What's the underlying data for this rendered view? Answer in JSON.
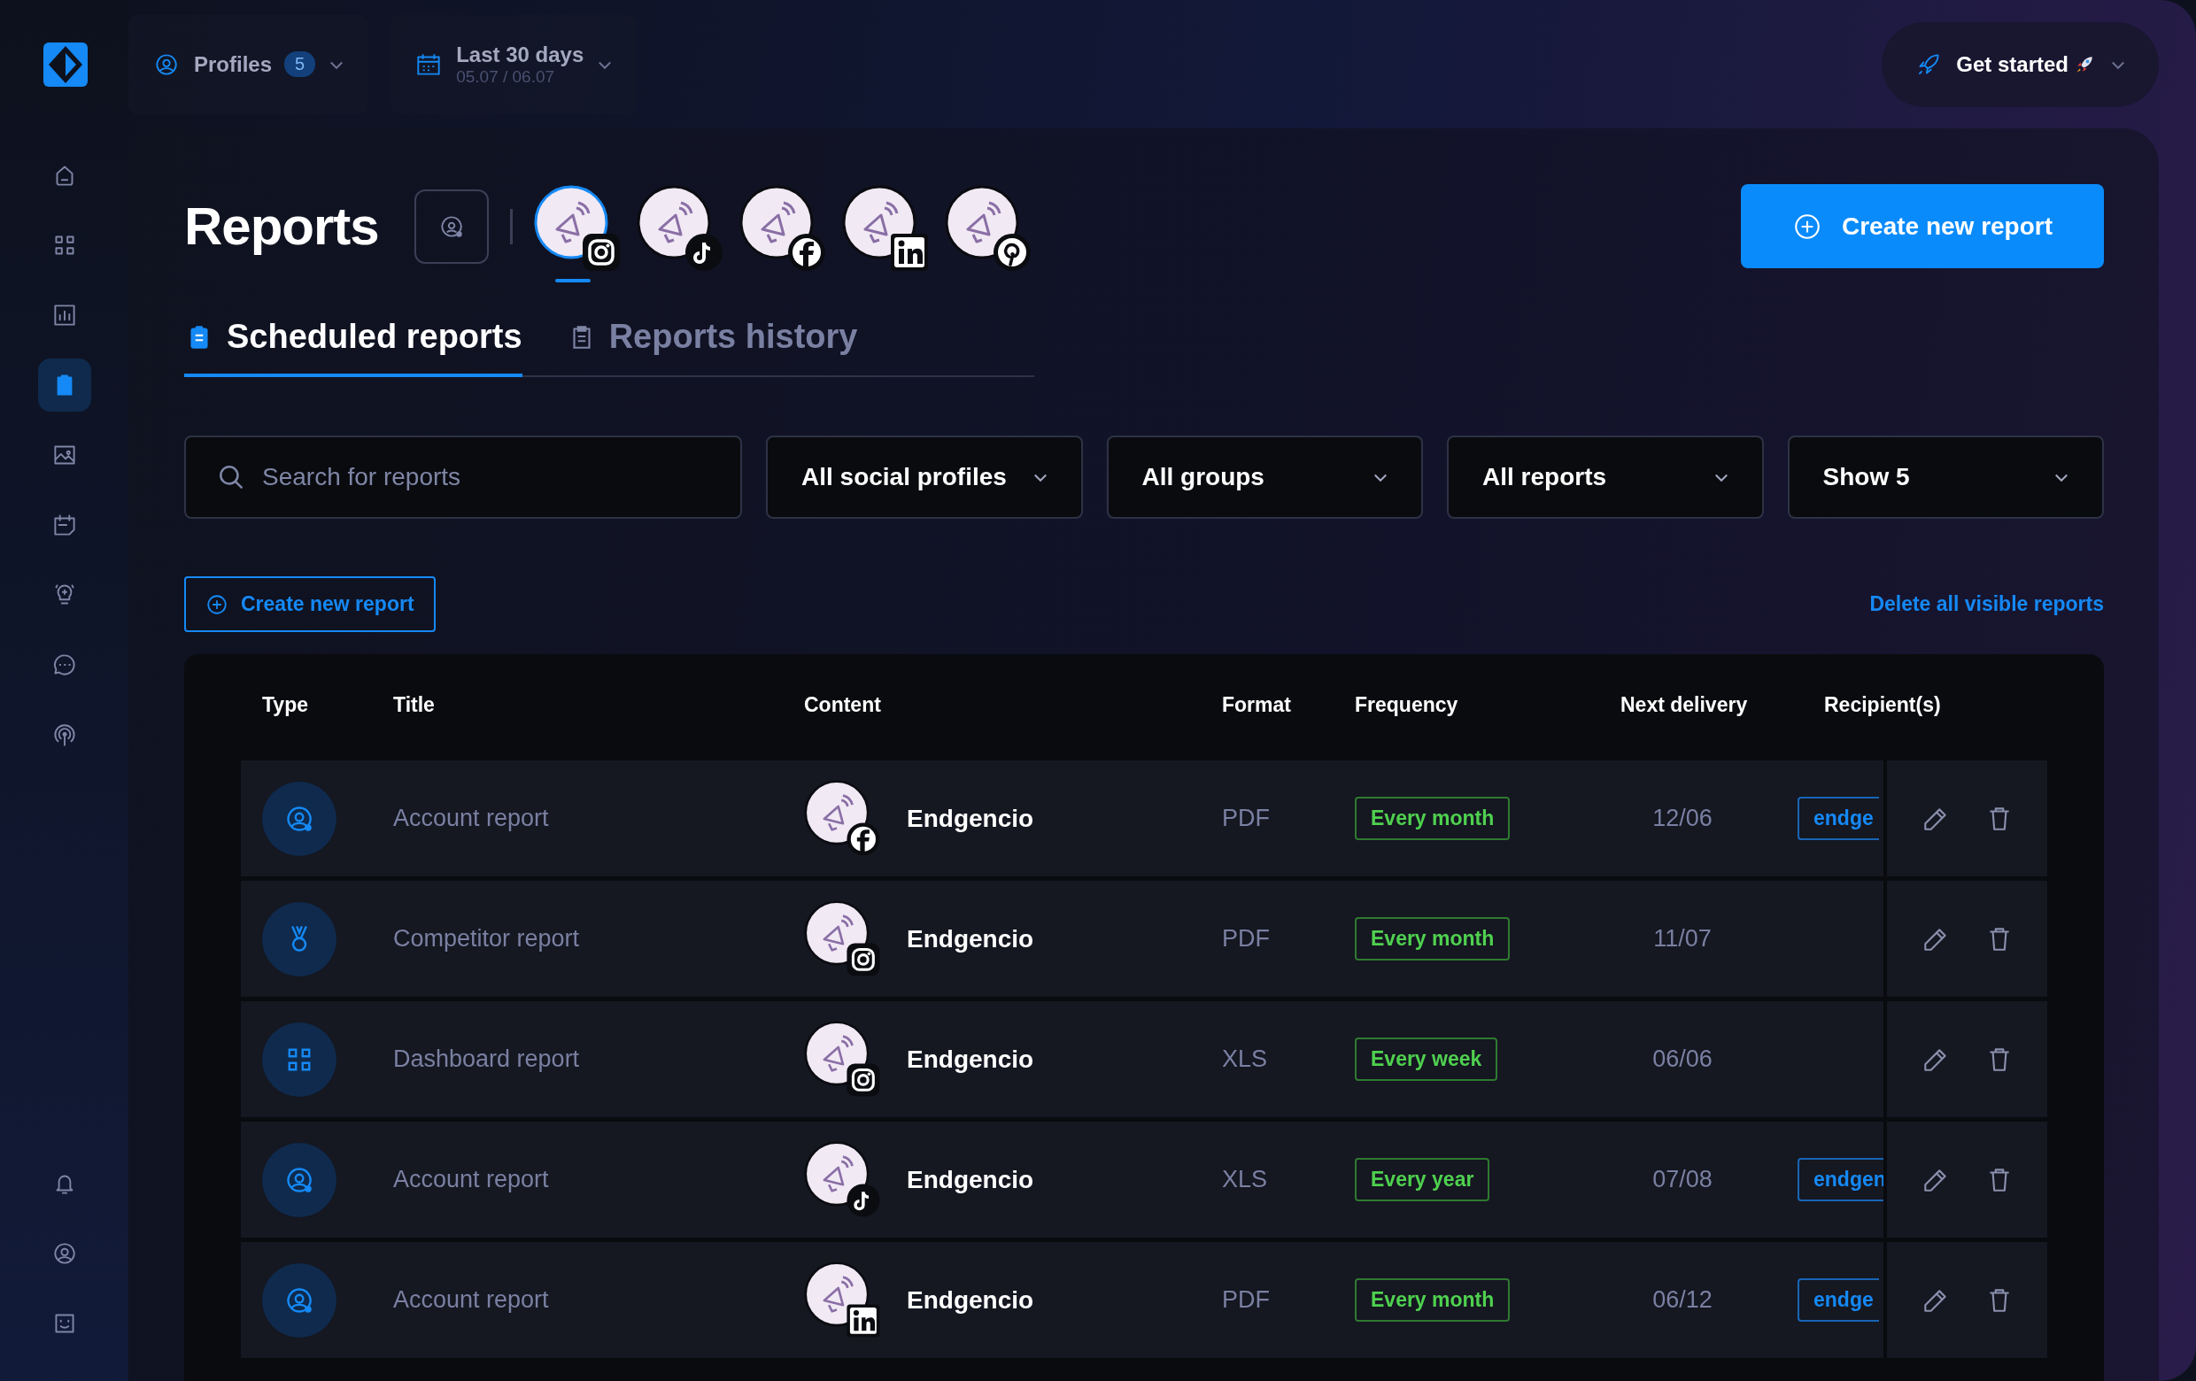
{
  "sidebar": {
    "items": [
      {
        "kind": "home",
        "selected": false
      },
      {
        "kind": "grid",
        "selected": false
      },
      {
        "kind": "chart",
        "selected": false
      },
      {
        "kind": "clipboard",
        "selected": true
      },
      {
        "kind": "image",
        "selected": false
      },
      {
        "kind": "calendar",
        "selected": false
      },
      {
        "kind": "bulb",
        "selected": false
      },
      {
        "kind": "chat",
        "selected": false
      },
      {
        "kind": "broadcast",
        "selected": false
      }
    ],
    "bottom_items": [
      {
        "kind": "bell"
      },
      {
        "kind": "user"
      },
      {
        "kind": "smile"
      }
    ]
  },
  "topbar": {
    "profiles": {
      "label": "Profiles",
      "count": "5"
    },
    "date_range": {
      "label": "Last 30 days",
      "dates": "05.07 / 06.07"
    },
    "get_started": {
      "label": "Get started"
    }
  },
  "header": {
    "title": "Reports",
    "profiles": [
      {
        "kind": "instagram",
        "selected": true
      },
      {
        "kind": "tiktok",
        "selected": false
      },
      {
        "kind": "facebook",
        "selected": false
      },
      {
        "kind": "linkedin",
        "selected": false
      },
      {
        "kind": "pinterest",
        "selected": false
      }
    ],
    "create_button": "Create new report"
  },
  "tabs": [
    {
      "label": "Scheduled reports",
      "selected": true
    },
    {
      "label": "Reports history",
      "selected": false
    }
  ],
  "filters": {
    "search": {
      "placeholder": "Search for reports"
    },
    "dropdowns": [
      "All social profiles",
      "All groups",
      "All reports",
      "Show 5"
    ]
  },
  "actions": {
    "create": "Create new report",
    "delete_all": "Delete all visible reports"
  },
  "table": {
    "columns": [
      "Type",
      "Title",
      "Content",
      "Format",
      "Frequency",
      "Next delivery",
      "Recipient(s)"
    ],
    "rows": [
      {
        "type": {
          "kind": "account"
        },
        "title": "Account report",
        "profile": {
          "kind": "facebook",
          "name": "Endgencio"
        },
        "format": "PDF",
        "frequency": "Every month",
        "next_delivery": "12/06",
        "recipients": [
          "endge"
        ]
      },
      {
        "type": {
          "kind": "competitor"
        },
        "title": "Competitor report",
        "profile": {
          "kind": "instagram",
          "name": "Endgencio"
        },
        "format": "PDF",
        "frequency": "Every month",
        "next_delivery": "11/07",
        "recipients": []
      },
      {
        "type": {
          "kind": "dashboard"
        },
        "title": "Dashboard report",
        "profile": {
          "kind": "instagram",
          "name": "Endgencio"
        },
        "format": "XLS",
        "frequency": "Every week",
        "next_delivery": "06/06",
        "recipients": []
      },
      {
        "type": {
          "kind": "account"
        },
        "title": "Account report",
        "profile": {
          "kind": "tiktok",
          "name": "Endgencio"
        },
        "format": "XLS",
        "frequency": "Every year",
        "next_delivery": "07/08",
        "recipients": [
          "endgen"
        ]
      },
      {
        "type": {
          "kind": "account"
        },
        "title": "Account report",
        "profile": {
          "kind": "linkedin",
          "name": "Endgencio"
        },
        "format": "PDF",
        "frequency": "Every month",
        "next_delivery": "06/12",
        "recipients": [
          "endge"
        ]
      }
    ]
  }
}
